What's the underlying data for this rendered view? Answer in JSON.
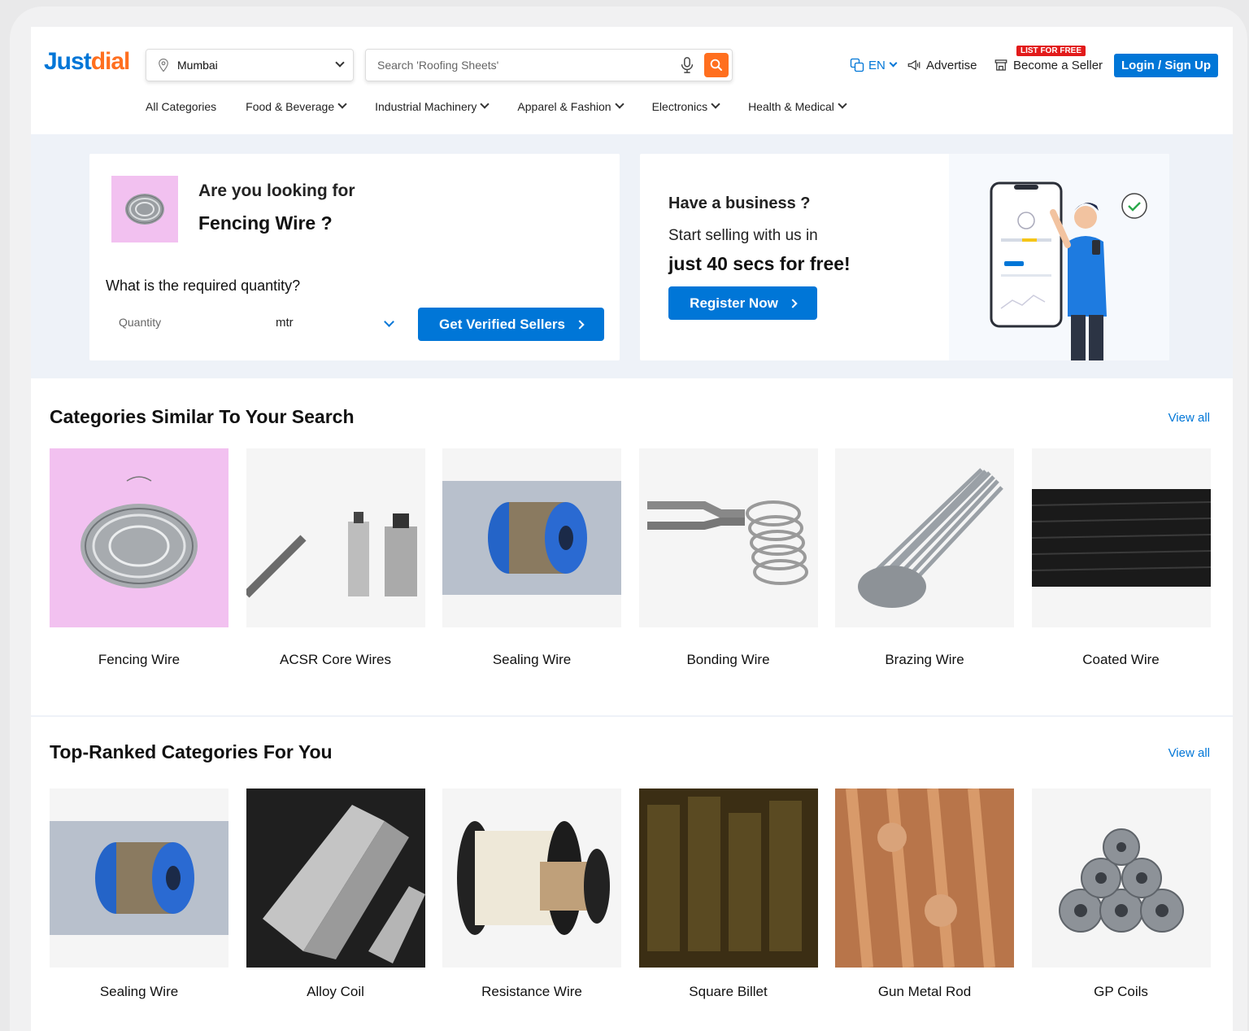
{
  "header": {
    "logo_part1": "Just",
    "logo_part2": "dial",
    "location": "Mumbai",
    "search_placeholder": "Search 'Roofing Sheets'",
    "language": "EN",
    "advertise": "Advertise",
    "list_for_free": "LIST FOR FREE",
    "become_seller": "Become a Seller",
    "login": "Login / Sign Up"
  },
  "nav": [
    {
      "label": "All Categories",
      "dropdown": false
    },
    {
      "label": "Food & Beverage",
      "dropdown": true
    },
    {
      "label": "Industrial Machinery",
      "dropdown": true
    },
    {
      "label": "Apparel & Fashion",
      "dropdown": true
    },
    {
      "label": "Electronics",
      "dropdown": true
    },
    {
      "label": "Health & Medical",
      "dropdown": true
    }
  ],
  "enquiry": {
    "looking_for": "Are you looking for",
    "product": "Fencing Wire ?",
    "question": "What is the required quantity?",
    "quantity_placeholder": "Quantity",
    "unit": "mtr",
    "cta": "Get Verified Sellers"
  },
  "business": {
    "heading": "Have a business ?",
    "line2": "Start selling with us in",
    "line3": "just 40 secs for free!",
    "cta": "Register Now"
  },
  "similar": {
    "title": "Categories Similar To Your Search",
    "view_all": "View all",
    "items": [
      {
        "label": "Fencing Wire",
        "icon": "barbed-wire-image"
      },
      {
        "label": "ACSR Core Wires",
        "icon": "acsr-cable-image"
      },
      {
        "label": "Sealing Wire",
        "icon": "wire-spool-image"
      },
      {
        "label": "Bonding Wire",
        "icon": "bonding-clamp-image"
      },
      {
        "label": "Brazing Wire",
        "icon": "brazing-rods-image"
      },
      {
        "label": "Coated Wire",
        "icon": "coated-wire-coil-image"
      }
    ]
  },
  "top_ranked": {
    "title": "Top-Ranked Categories For You",
    "view_all": "View all",
    "items": [
      {
        "label": "Sealing Wire",
        "icon": "wire-spool-image"
      },
      {
        "label": "Alloy Coil",
        "icon": "hex-bars-image"
      },
      {
        "label": "Resistance Wire",
        "icon": "resistance-spool-image"
      },
      {
        "label": "Square Billet",
        "icon": "billet-stack-image"
      },
      {
        "label": "Gun Metal Rod",
        "icon": "copper-rods-image"
      },
      {
        "label": "GP Coils",
        "icon": "steel-coils-image"
      }
    ]
  },
  "colors": {
    "brand_blue": "#0076d7",
    "brand_orange": "#ff6f1f",
    "pink_thumb": "#f2c1f0"
  }
}
